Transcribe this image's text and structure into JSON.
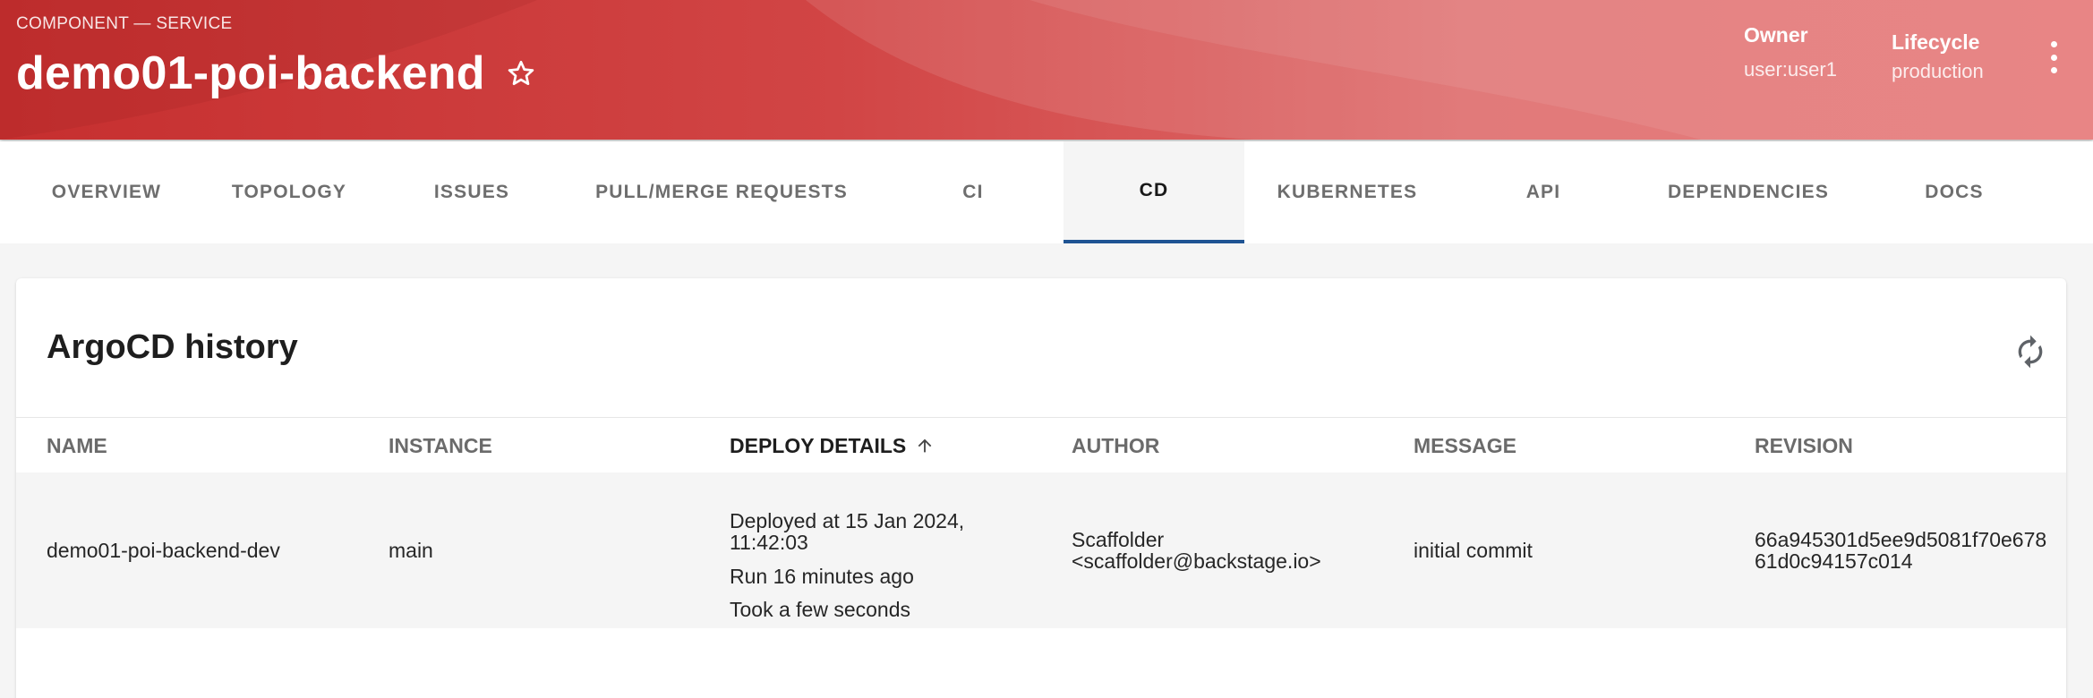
{
  "header": {
    "eyebrow": "COMPONENT — SERVICE",
    "title": "demo01-poi-backend",
    "owner_label": "Owner",
    "owner_value": "user:user1",
    "lifecycle_label": "Lifecycle",
    "lifecycle_value": "production",
    "colors": {
      "primary": "#c62f2f",
      "accent": "#e46c6c"
    }
  },
  "tabs": [
    {
      "label": "OVERVIEW"
    },
    {
      "label": "TOPOLOGY"
    },
    {
      "label": "ISSUES"
    },
    {
      "label": "PULL/MERGE REQUESTS"
    },
    {
      "label": "CI"
    },
    {
      "label": "CD",
      "active": true
    },
    {
      "label": "KUBERNETES"
    },
    {
      "label": "API"
    },
    {
      "label": "DEPENDENCIES"
    },
    {
      "label": "DOCS"
    }
  ],
  "card": {
    "title": "ArgoCD history",
    "refresh_icon": "refresh-icon",
    "columns": [
      "NAME",
      "INSTANCE",
      "DEPLOY DETAILS",
      "AUTHOR",
      "MESSAGE",
      "REVISION"
    ],
    "sort_column": "DEPLOY DETAILS",
    "rows": [
      {
        "name": "demo01-poi-backend-dev",
        "instance": "main",
        "deployed_at": "Deployed at 15 Jan 2024, 11:42:03",
        "run": "Run 16 minutes ago",
        "took": "Took a few seconds",
        "author": "Scaffolder <scaffolder@backstage.io>",
        "message": "initial commit",
        "revision": "66a945301d5ee9d5081f70e67861d0c94157c014"
      }
    ]
  },
  "colors": {
    "tab_indicator": "#1f5493"
  }
}
